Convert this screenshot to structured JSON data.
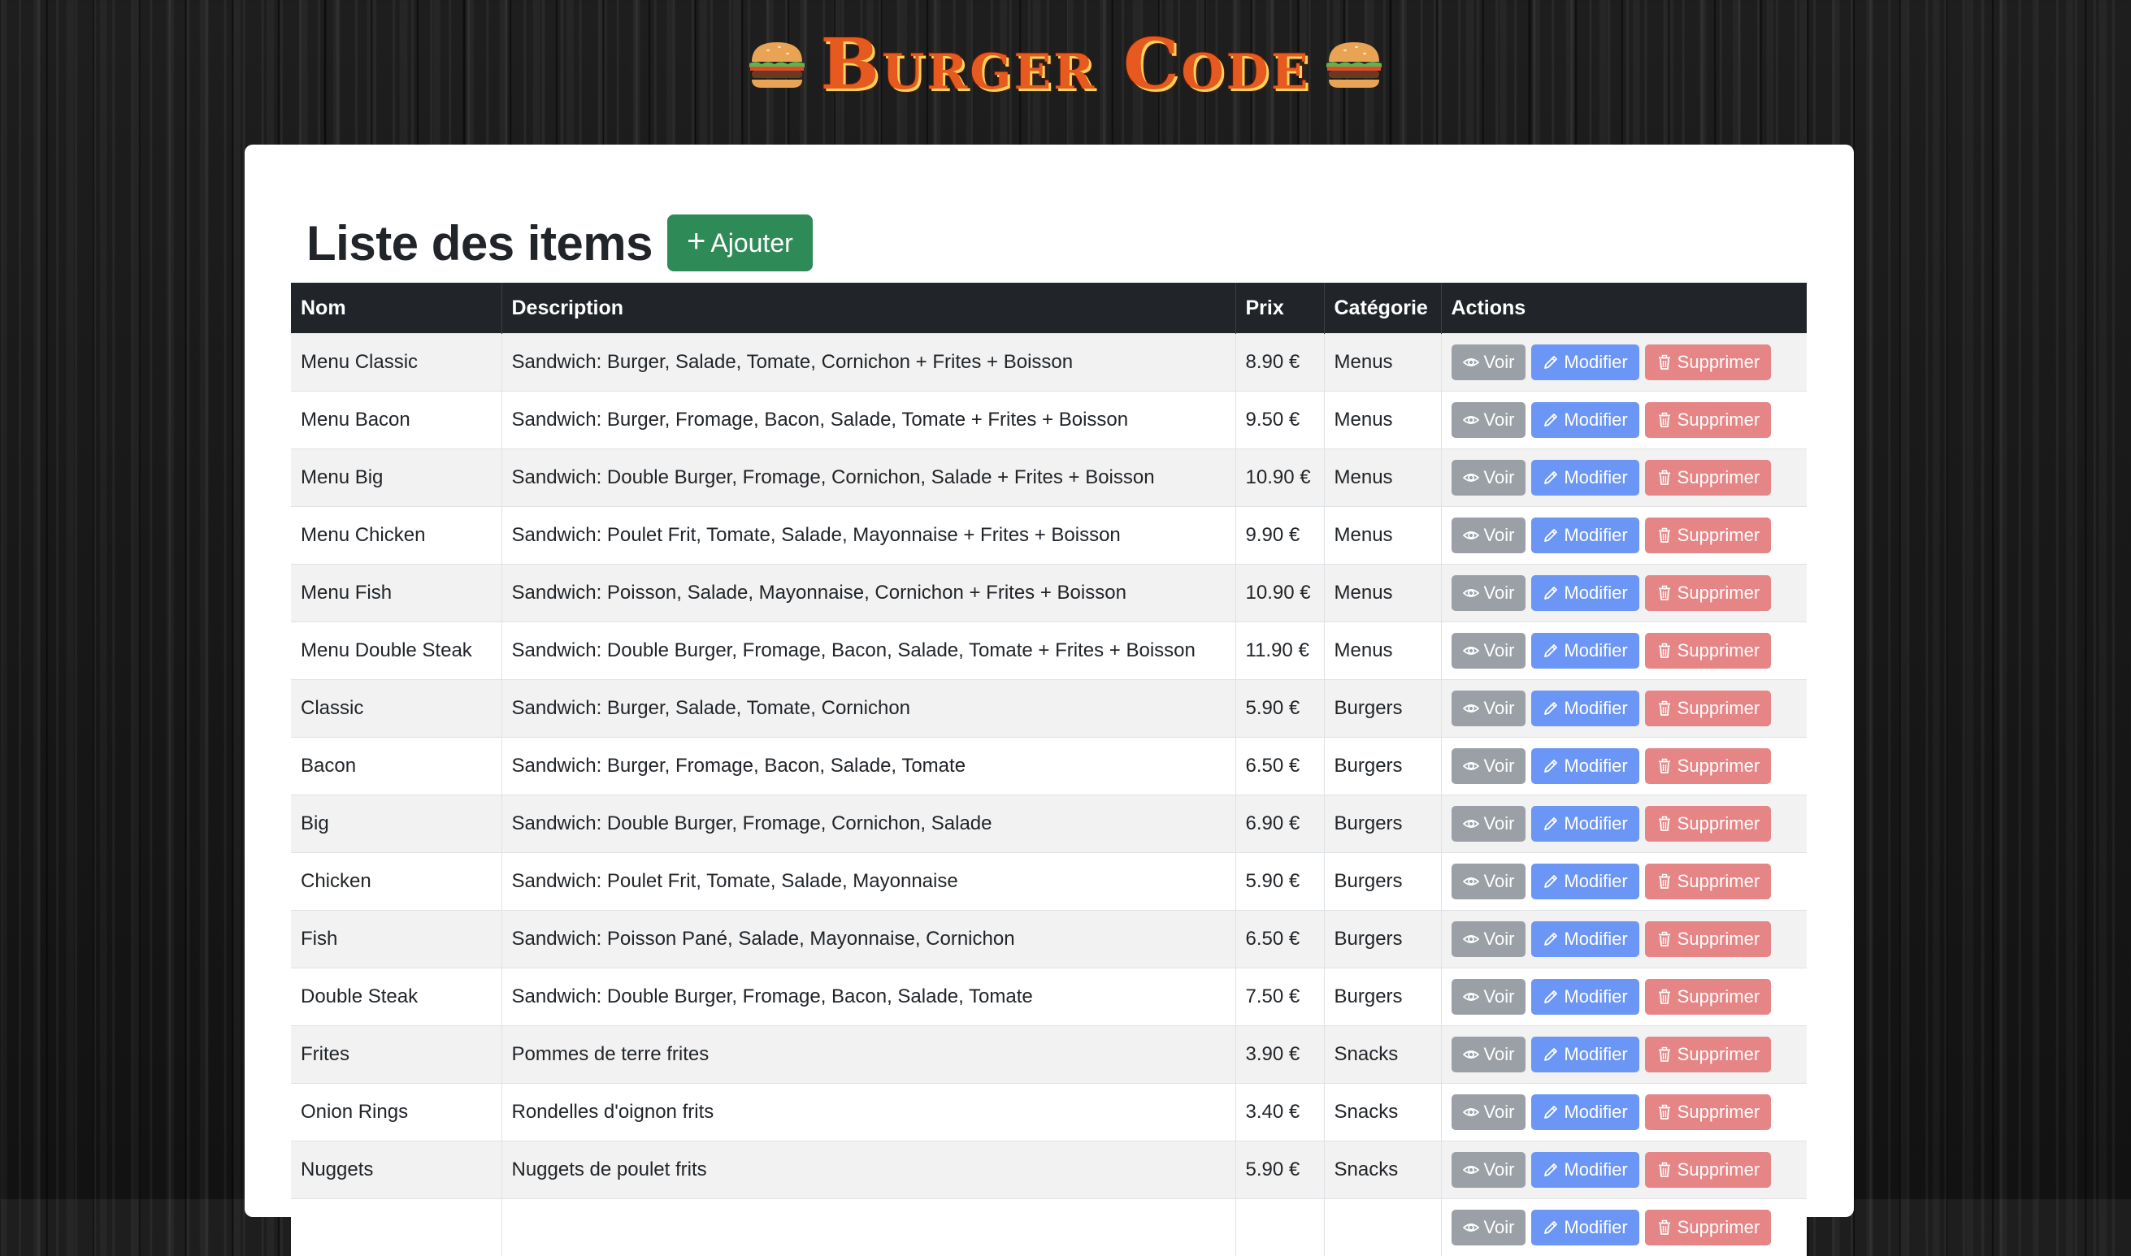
{
  "header": {
    "title": "Burger Code"
  },
  "page": {
    "title": "Liste des items",
    "add_label": "Ajouter"
  },
  "table": {
    "columns": [
      "Nom",
      "Description",
      "Prix",
      "Catégorie",
      "Actions"
    ],
    "actions": {
      "view": "Voir",
      "edit": "Modifier",
      "delete": "Supprimer"
    },
    "rows": [
      {
        "name": "Menu Classic",
        "description": "Sandwich: Burger, Salade, Tomate, Cornichon + Frites + Boisson",
        "price": "8.90 €",
        "category": "Menus"
      },
      {
        "name": "Menu Bacon",
        "description": "Sandwich: Burger, Fromage, Bacon, Salade, Tomate + Frites + Boisson",
        "price": "9.50 €",
        "category": "Menus"
      },
      {
        "name": "Menu Big",
        "description": "Sandwich: Double Burger, Fromage, Cornichon, Salade + Frites + Boisson",
        "price": "10.90 €",
        "category": "Menus"
      },
      {
        "name": "Menu Chicken",
        "description": "Sandwich: Poulet Frit, Tomate, Salade, Mayonnaise + Frites + Boisson",
        "price": "9.90 €",
        "category": "Menus"
      },
      {
        "name": "Menu Fish",
        "description": "Sandwich: Poisson, Salade, Mayonnaise, Cornichon + Frites + Boisson",
        "price": "10.90 €",
        "category": "Menus"
      },
      {
        "name": "Menu Double Steak",
        "description": "Sandwich: Double Burger, Fromage, Bacon, Salade, Tomate + Frites + Boisson",
        "price": "11.90 €",
        "category": "Menus"
      },
      {
        "name": "Classic",
        "description": "Sandwich: Burger, Salade, Tomate, Cornichon",
        "price": "5.90 €",
        "category": "Burgers"
      },
      {
        "name": "Bacon",
        "description": "Sandwich: Burger, Fromage, Bacon, Salade, Tomate",
        "price": "6.50 €",
        "category": "Burgers"
      },
      {
        "name": "Big",
        "description": "Sandwich: Double Burger, Fromage, Cornichon, Salade",
        "price": "6.90 €",
        "category": "Burgers"
      },
      {
        "name": "Chicken",
        "description": "Sandwich: Poulet Frit, Tomate, Salade, Mayonnaise",
        "price": "5.90 €",
        "category": "Burgers"
      },
      {
        "name": "Fish",
        "description": "Sandwich: Poisson Pané, Salade, Mayonnaise, Cornichon",
        "price": "6.50 €",
        "category": "Burgers"
      },
      {
        "name": "Double Steak",
        "description": "Sandwich: Double Burger, Fromage, Bacon, Salade, Tomate",
        "price": "7.50 €",
        "category": "Burgers"
      },
      {
        "name": "Frites",
        "description": "Pommes de terre frites",
        "price": "3.90 €",
        "category": "Snacks"
      },
      {
        "name": "Onion Rings",
        "description": "Rondelles d'oignon frits",
        "price": "3.40 €",
        "category": "Snacks"
      },
      {
        "name": "Nuggets",
        "description": "Nuggets de poulet frits",
        "price": "5.90 €",
        "category": "Snacks"
      },
      {
        "name": "",
        "description": "",
        "price": "",
        "category": ""
      }
    ]
  },
  "colors": {
    "brand": "#e65a1f",
    "add_button": "#2e8b57",
    "view_button": "#9aa0a6",
    "edit_button": "#6c96f5",
    "delete_button": "#e68586",
    "table_header": "#212529"
  },
  "icons": {
    "brand": "burger-icon",
    "add": "plus-icon",
    "view": "eye-icon",
    "edit": "pencil-icon",
    "delete": "trash-icon"
  }
}
